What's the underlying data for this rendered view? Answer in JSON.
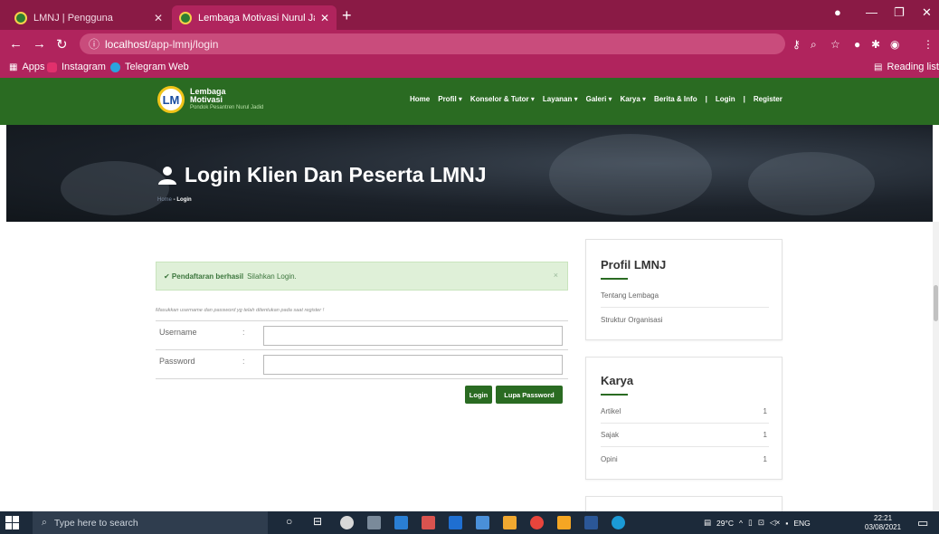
{
  "browser": {
    "tabs": [
      {
        "title": "LMNJ | Pengguna",
        "active": false
      },
      {
        "title": "Lembaga Motivasi Nurul Jadid - L",
        "active": true
      }
    ],
    "url_host": "localhost",
    "url_path": "/app-lmnj/login",
    "bookmarks": [
      "Apps",
      "Instagram",
      "Telegram Web"
    ],
    "reading_list": "Reading list"
  },
  "site": {
    "logo": {
      "line1": "Lembaga",
      "line2": "Motivasi",
      "line3": "Pondok Pesantren Nurul Jadid"
    },
    "menu": [
      "Home",
      "Profil ▾",
      "Konselor & Tutor ▾",
      "Layanan ▾",
      "Galeri ▾",
      "Karya ▾",
      "Berita & Info",
      "|",
      "Login",
      "|",
      "Register"
    ]
  },
  "hero": {
    "title": "Login Klien Dan Peserta LMNJ",
    "crumb_home": "Home",
    "crumb_current": "Login"
  },
  "login": {
    "alert_bold": "✔ Pendaftaran berhasil",
    "alert_text": "Silahkan Login.",
    "alert_close": "×",
    "hint": "Masukkan username dan password yg telah ditentukan pada saat register !",
    "username_label": "Username",
    "password_label": "Password",
    "colon": ":",
    "username_value": "",
    "password_value": "",
    "login_button": "Login",
    "forgot_button": "Lupa Password"
  },
  "profil": {
    "title": "Profil LMNJ",
    "items": [
      "Tentang Lembaga",
      "Struktur Organisasi"
    ]
  },
  "karya": {
    "title": "Karya",
    "items": [
      {
        "label": "Artikel",
        "count": "1"
      },
      {
        "label": "Sajak",
        "count": "1"
      },
      {
        "label": "Opini",
        "count": "1"
      }
    ]
  },
  "taskbar": {
    "search_placeholder": "Type here to search",
    "weather": "29°C",
    "lang": "ENG",
    "time": "22:21",
    "date": "03/08/2021"
  }
}
